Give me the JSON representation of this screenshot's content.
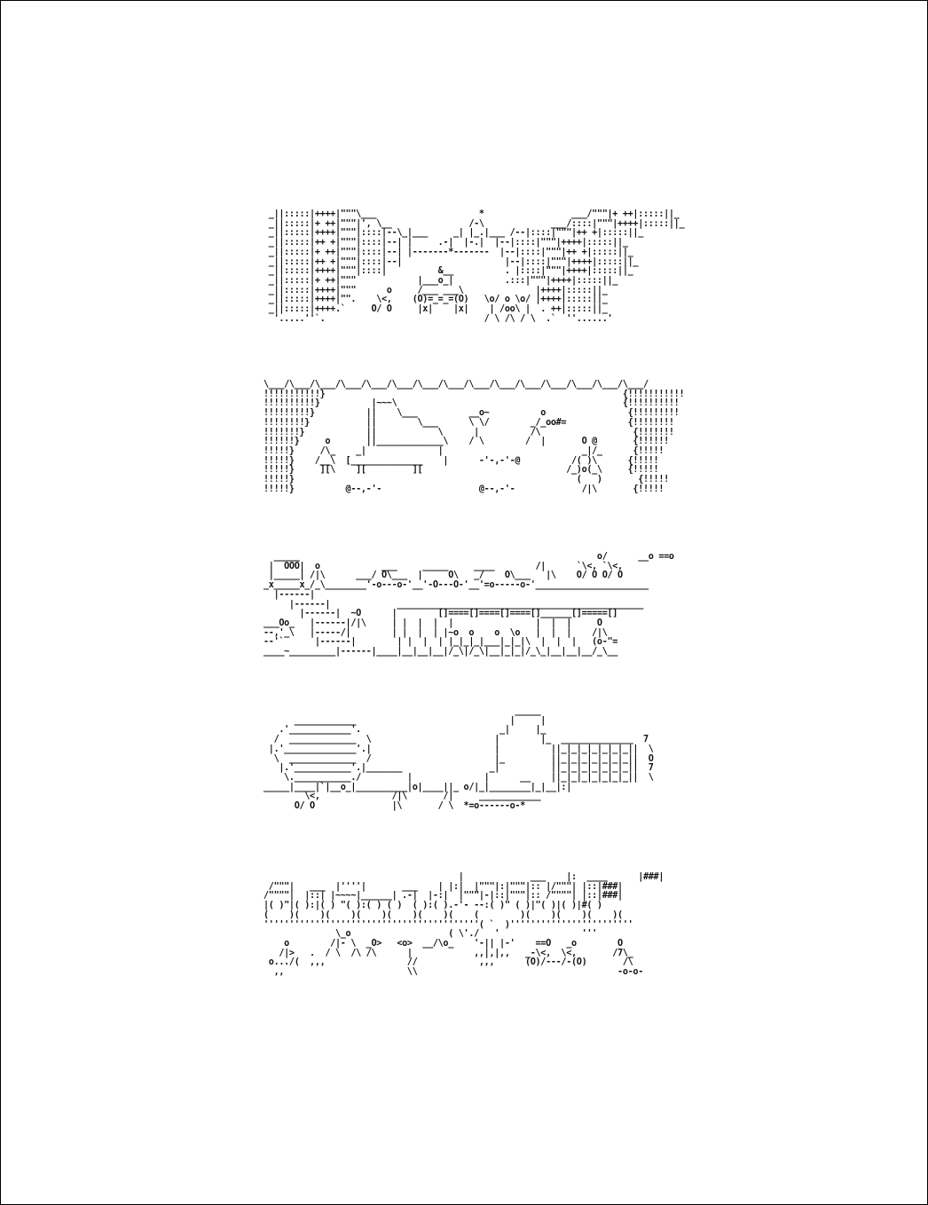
{
  "document": {
    "panels": [
      {
        "id": "city-street",
        "art": " _||:::::|++++|\"\"\"\\___                    *                 ___/\"\"\"|+ ++|:::::||_\n _||:::::|+ ++|\"\"\"|', \\__               /-\\             ___/::::|\"\"\"|++++|:::::||_\n _||:::::|++++|\"\"\"|::::|--\\_|___     _| |_.|___ /--|::::|\"\"\"|++ +|:::::||_\n _||:::::|++ +|\"\"\"|::::|--| |     .-|  |-.|  |--|::::|\"\"\"|++++|:::::||_\n _||:::::|+ ++|\"\"\"|::::|--| |-------*-------  |--|::::|\"\"\"|++ +|:::::||_\n _||:::::|++ +|\"\"\"|::::|--|                    |--|::::|\"\"\"|++++|:::::||_\n _||:::::|++++|\"\"\"|::::|          &__          . |::::|\"\"\"|++++|:::::||_\n _||:::::|+ ++|\"\"\"            |___o_|          .:::|\"\"\"|++++|:::::||_\n _||:::::|++++|\"\"\"      o     /___ ___\\              |++++|:::::||_\n _||:::::|++++|\"\".    \\<,    (O)=_=_=(O)   \\o/ o \\o/ |++++|:::::||_\n _||:::::|++++.`     O/ O     |x|    |x|    | /oo\\ |  . ++|:::::||_\n  '.....''`.                               / \\ /\\ / \\  .`  ''......'"
      },
      {
        "id": "concert-hall",
        "art": "\\___/\\___/\\___/\\___/\\___/\\___/\\___/\\___/\\___/\\___/\\___/\\___/\\___/\\___/\\___/\n!!!!!!!!!!!}                                                          {!!!!!!!!!!!\n!!!!!!!!!!}          |~~~\\                                            {!!!!!!!!!!\n!!!!!!!!!}          ||    \\___          __o~          o                {!!!!!!!!!\n!!!!!!!!}           ||        \\___      \\ \\/        _/_oo#=            {!!!!!!!!\n!!!!!!!}            ||            \\      |          /\\                  {!!!!!!!\n!!!!!!}     o       ||_____________\\    / \\        /  |       O @       {!!!!!!\n!!!!!}     /\\_    _|              |                           _|/_      {!!!!!\n!!!!!}    /__\\  [______________    |      -'-,-'-@          /( )\\      {!!!!!\n!!!!!}     ][\\    ][         ][                            /_)o(_\\     {!!!!!\n!!!!!}                                                       (   )       {!!!!!\n!!!!!}          @--,-'-                   @--,-'-             /|\\       {!!!!!"
      },
      {
        "id": "traffic-and-train",
        "art": "  _____                                                          o/      __o ==o\n |  OOO|  o            ___     _____     ____        /|      `\\<, `\\<,\n |_____| /|\\      ___/ O\\___  |     O\\   _/    O\\___   |\\    O/ O O/ O\n_x_____x_/_\\________'-o---o-'__'-O---O-'__'=o-----o-'______________________\n  |------|\n     |------|             ________________________________________________\n       |------|  ~O      |        []====[]====[]====[]______[]=====[]\n___Oo_   |------|/|\\     | |  |  |  |                |  |  |     O\n--,'_\\   |-----/|        | |  |  | |~o  o    o  \\o   |  |  |    /|\\\n--'`      |------|        | |  |  | |_|_|_|___|_|_|\\  |  |  |   (o-\"=\n____~_________|------|____|__|__|__|/_\\|/_\\|__|_|_|/_\\_|__|__|__/_\\__"
      },
      {
        "id": "stadium-and-building",
        "art": "                                                 _____\n      ____________                              |     |\n   .'____________'.                           _|     |_\n  /  _____________  \\                        |        |_  ______________  7\n |.'______________'.|                        |          ||_|_|_|_|_|_|_||  \\\n  \\  _____________  /                        |_         ||_|_|_|_|_|_|_||  O\n   |.'___________'.|_______                 _|          ||_|_|_|_|_|_|_||  7\n    \\.___________./         |              |      __    ||_|_|_|_|_|_|_||  \\\n_____|____|`|__o_|__________|o|____||_ o/|_|________|_|__|:|\n        \\<,              /|\\       /|     ____________\n      O/ O               |\\       / \\  *=o------o-*"
      },
      {
        "id": "market-street",
        "art": "                                      |             ___    |:  ____      |###|\n /\"\"\"|   ___  |''''|       ___    | |:|  |\"\"\"|:|\"\"\"|:: |/\"\"\"| |::|###|\n/\"\"\"\"|  |::| |~~~~|______| .-|  |-:|  |\"\"\"|-|::|\"\"\"|:: /\"\"\"\"| |::|###|\n|( )\"|( ):|( ) \"( ):( ) ( )  ( ):( ).-'- --:( )\" ( )|\"( )|( )|#( )\n(    )(    )(    )(    )(    )(    )(    (        )(    )(    )(    )(\n''''''''''''''''''''''''''''''''''''''''''( `  )''''''''''''''''''''''''\n              \\_o                   ( \\'./   '                '''\n    o        /|- \\  _O>   <o>  __/\\o_    '-|| |-'    ==O   _o        O\n   /|>   .  / \\  /\\ /\\      |            ,,|,|,,   _-\\<,  \\<,       /7\\_\n o.../(  ,,,                //            ,,,      (O)/---/-(O)       /\\\n  ,,                        \\\\                                       -o-o-"
      }
    ]
  }
}
